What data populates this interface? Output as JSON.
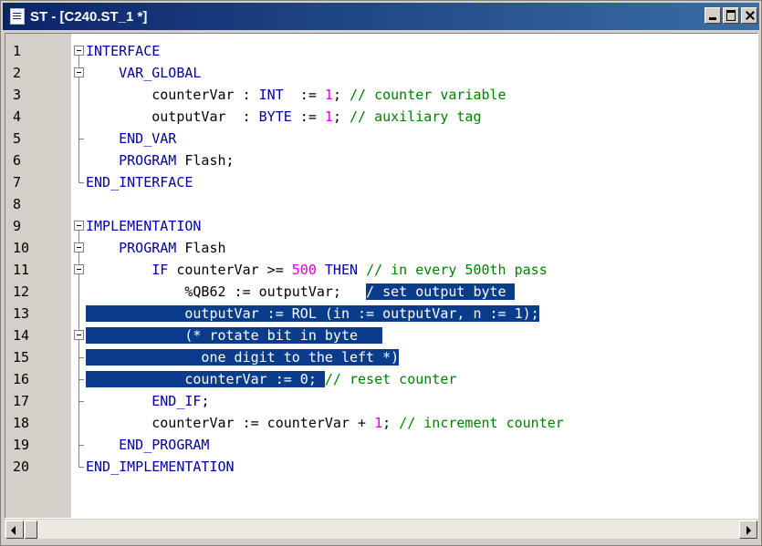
{
  "window": {
    "title": "ST - [C240.ST_1 *]",
    "buttons": [
      "minimize",
      "maximize",
      "close"
    ]
  },
  "colors": {
    "keyword": "#0000a0",
    "number": "#e000e0",
    "comment": "#008000",
    "selection": "#0a3c8c",
    "gutter": "#d4d0c8"
  },
  "editor": {
    "lines": [
      {
        "n": "1",
        "segments": [
          [
            "kw",
            "INTERFACE"
          ]
        ]
      },
      {
        "n": "2",
        "segments": [
          [
            "plain",
            "    "
          ],
          [
            "kw",
            "VAR_GLOBAL"
          ]
        ]
      },
      {
        "n": "3",
        "segments": [
          [
            "plain",
            "        counterVar : "
          ],
          [
            "kw",
            "INT"
          ],
          [
            "plain",
            "  := "
          ],
          [
            "num",
            "1"
          ],
          [
            "plain",
            "; "
          ],
          [
            "cm",
            "// counter variable"
          ]
        ]
      },
      {
        "n": "4",
        "segments": [
          [
            "plain",
            "        outputVar  : "
          ],
          [
            "kw",
            "BYTE"
          ],
          [
            "plain",
            " := "
          ],
          [
            "num",
            "1"
          ],
          [
            "plain",
            "; "
          ],
          [
            "cm",
            "// auxiliary tag"
          ]
        ]
      },
      {
        "n": "5",
        "segments": [
          [
            "plain",
            "    "
          ],
          [
            "kw",
            "END_VAR"
          ]
        ]
      },
      {
        "n": "6",
        "segments": [
          [
            "plain",
            "    "
          ],
          [
            "kw",
            "PROGRAM"
          ],
          [
            "plain",
            " Flash;"
          ]
        ]
      },
      {
        "n": "7",
        "segments": [
          [
            "kw",
            "END_INTERFACE"
          ]
        ]
      },
      {
        "n": "8",
        "segments": []
      },
      {
        "n": "9",
        "segments": [
          [
            "kw",
            "IMPLEMENTATION"
          ]
        ]
      },
      {
        "n": "10",
        "segments": [
          [
            "plain",
            "    "
          ],
          [
            "kw",
            "PROGRAM"
          ],
          [
            "plain",
            " Flash"
          ]
        ]
      },
      {
        "n": "11",
        "segments": [
          [
            "plain",
            "        "
          ],
          [
            "kw",
            "IF"
          ],
          [
            "plain",
            " counterVar >= "
          ],
          [
            "num",
            "500"
          ],
          [
            "plain",
            " "
          ],
          [
            "kw",
            "THEN"
          ],
          [
            "plain",
            " "
          ],
          [
            "cm",
            "// in every 500th pass"
          ]
        ]
      },
      {
        "n": "12",
        "segments": [
          [
            "plain",
            "            %QB62 := outputVar;   "
          ],
          [
            "selcm",
            "/ set output byte "
          ]
        ]
      },
      {
        "n": "13",
        "segments": [
          [
            "sel",
            "            outputVar := ROL (in := outputVar, n := 1);"
          ]
        ]
      },
      {
        "n": "14",
        "segments": [
          [
            "sel",
            "            (* rotate bit in byte   "
          ]
        ]
      },
      {
        "n": "15",
        "segments": [
          [
            "sel",
            "              one digit to the left *)"
          ]
        ]
      },
      {
        "n": "16",
        "segments": [
          [
            "sel",
            "            counterVar := 0; "
          ],
          [
            "cm",
            "// reset counter"
          ]
        ]
      },
      {
        "n": "17",
        "segments": [
          [
            "plain",
            "        "
          ],
          [
            "kw",
            "END_IF"
          ],
          [
            "plain",
            ";"
          ]
        ]
      },
      {
        "n": "18",
        "segments": [
          [
            "plain",
            "        counterVar := counterVar + "
          ],
          [
            "num",
            "1"
          ],
          [
            "plain",
            "; "
          ],
          [
            "cm",
            "// increment counter"
          ]
        ]
      },
      {
        "n": "19",
        "segments": [
          [
            "plain",
            "    "
          ],
          [
            "kw",
            "END_PROGRAM"
          ]
        ]
      },
      {
        "n": "20",
        "segments": [
          [
            "kw",
            "END_IMPLEMENTATION"
          ]
        ]
      }
    ],
    "fold_markers": [
      "box",
      "box",
      "line",
      "line",
      "tick",
      "line",
      "end",
      "",
      "box",
      "box",
      "box",
      "line",
      "line",
      "box",
      "tick",
      "tick",
      "tick",
      "line",
      "tick",
      "end"
    ]
  }
}
